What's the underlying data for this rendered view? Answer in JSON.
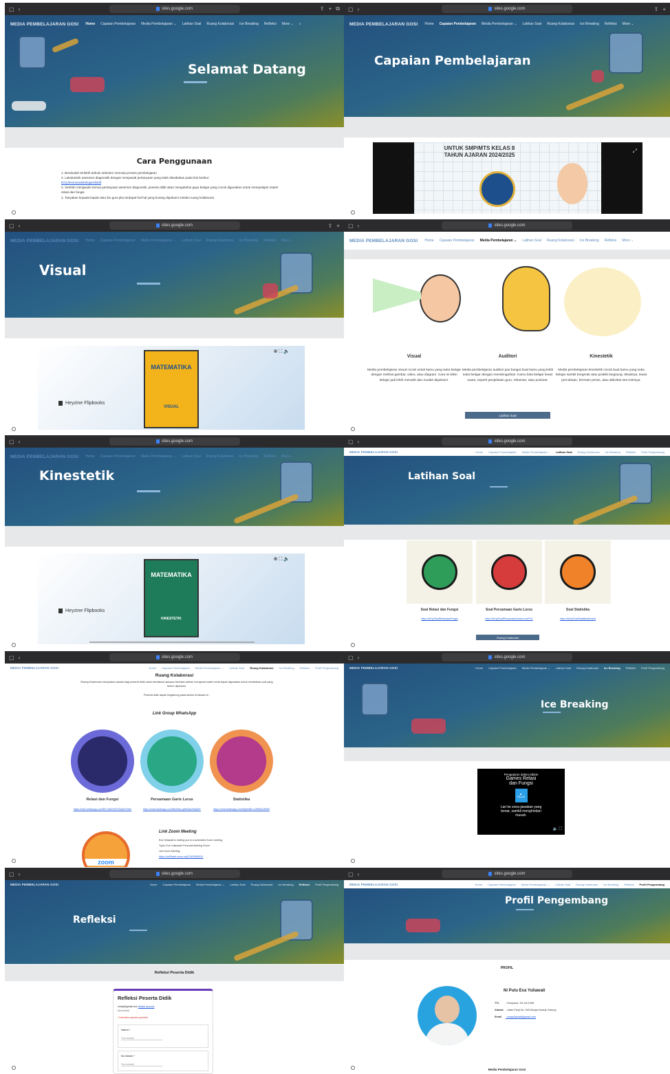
{
  "browser": {
    "url": "sites.google.com"
  },
  "site": {
    "brand": "MEDIA PEMBELAJARAN GOSI",
    "nav": [
      "Home",
      "Capaian Pembelajaran",
      "Media Pembelajaran ⌄",
      "Latihan Soal",
      "Ruang Kolaborasi",
      "Ice Breaking",
      "Refleksi",
      "More ⌄"
    ],
    "nav_wide": [
      "Home",
      "Capaian Pembelajaran",
      "Media Pembelajaran ⌄",
      "Latihan Soal",
      "Ruang Kolaborasi",
      "Ice Breaking",
      "Refleksi",
      "Profil Pengembang"
    ]
  },
  "p1": {
    "title": "Selamat Datang",
    "heading": "Cara Penggunaan",
    "steps": [
      "1. Berdoalah terlebih dahulu sebelum memulai proses pembelajaran",
      "2. Lakukanlah asesmen diagnostik dengan menjawab pertanyaan yang telah disediakan pada link berikut :",
      "bit.ly/tesmetodebelajarefektif",
      "3. Setelah menjawab semua pertanyaan asesmen diagnostik, peserta didik akan mengetahui gaya belajar yang cocok digunakan untuk mempelajari materi relasi dan fungsi.",
      "4. Tanyakan kepada bapak atau ibu guru jika terdapat hal-hal yang kurang dipahami melalui ruang kolaborasi."
    ]
  },
  "p2": {
    "title": "Capaian Pembelajaran",
    "slide_line1": "UNTUK SMP/MTS KELAS 8",
    "slide_line2": "TAHUN AJARAN 2024/2025"
  },
  "p3": {
    "title": "Visual",
    "book_title": "MATEMATIKA",
    "book_tag": "VISUAL",
    "flip": "Heyzine Flipbooks"
  },
  "p4": {
    "cols": [
      {
        "name": "Visual",
        "desc": "Media pembelajaran visual cocok untuk kamu yang suka belajar dengan melihat gambar, video, atau diagram. Cara ini bikin belajar jadi lebih menarik dan mudah dipahami."
      },
      {
        "name": "Auditori",
        "desc": "Media pembelajaran auditori pas banget buat kamu yang lebih suka belajar dengan mendengarkan. Kamu bisa belajar lewat suara, seperti penjelasan guru, rekaman, atau podcast."
      },
      {
        "name": "Kinestetik",
        "desc": "Media pembelajaran kinestetik cocok buat kamu yang suka belajar sambil bergerak atau praktik langsung. Misalnya, lewat percobaan, bermain peran, atau aktivitas seru lainnya."
      }
    ],
    "button": "Latihan Soal"
  },
  "p5": {
    "title": "Kinestetik",
    "book_title": "MATEMATIKA",
    "book_tag": "KINESTETIK",
    "flip": "Heyzine Flipbooks"
  },
  "p6": {
    "title": "Latihan Soal",
    "cards": [
      {
        "name": "Soal Relasi dan Fungsi",
        "link": "https://bit.ly/SoalRelasidanFungsi"
      },
      {
        "name": "Soal Persamaan Garis Lurus",
        "link": "https://bit.ly/SoalPersamaanGarisLurusPGL"
      },
      {
        "name": "Soal Statistika",
        "link": "https://bit.ly/SoalStatistikaKelas8"
      }
    ],
    "button": "Ruang Kolaborasi"
  },
  "p7": {
    "title": "Ruang Kolaborasi",
    "intro": "Ruang Kolaborasi merupakan wadah bagi peserta didik untuk berdiskusi ataupun bertukar pikiran mengenai materi serta dapat digunakan untuk membahas soal yang belum dipahami.",
    "join": "Peserta didik dapat bergabung pada tautan di bawah ini :",
    "wa": "Link Group WhatsApp",
    "groups": [
      {
        "name": "Relasi dan Fungsi",
        "link": "https://chat.whatsapp.com/BYYwtNcF67lCkaNYHdiU"
      },
      {
        "name": "Persamaan Garis Lurus",
        "link": "https://chat.whatsapp.com/BmNbzs qfdWdwAdKpEK"
      },
      {
        "name": "Statistika",
        "link": "https://chat.whatsapp.com/Mpb9dB xc49R6Ju9R83"
      }
    ],
    "zoom_h": "Link Zoom Meeting",
    "zoom_lines": [
      "Eva Yuliawati is inviting you to a scheduled Zoom meeting.",
      "Topic: Eva Yuliawati's Personal Meeting Room",
      "Join Zoom Meeting",
      "https://us05web.zoom.us/j/71676595151"
    ],
    "zoom_logo": "zoom"
  },
  "p8": {
    "title": "Ice Breaking",
    "game_lines": [
      "Pengejaran dalam labirin",
      "Games Relasi",
      "dan Fungsi"
    ],
    "play": "MULAI",
    "foot": "Lari ke zona jawaban yang benar, sambil menghindari musuh."
  },
  "p9": {
    "title": "Refleksi",
    "bar": "Refleksi Peserta Didik",
    "form_title": "Refleksi Peserta Didik",
    "email": "srimpi@gmail.com",
    "switch": "Switch account",
    "not_shared": "Not shared",
    "required": "* Indicates required question",
    "f1": "Nama *",
    "f1p": "Your answer",
    "f2": "No Absen *",
    "f2p": "Your answer"
  },
  "p10": {
    "title": "Profil Pengembang",
    "label": "PROFIL",
    "name": "Ni Putu Eva Yuliawati",
    "ttl_k": "TTL",
    "ttl_v": ": Denpasar, 28 Juli 1998",
    "alamat_k": "Alamat",
    "alamat_v": ": Jalan Panji No. 540 Banjar Kwanji, Dalung",
    "email_k": "Email",
    "email_v": ": evayuliawati@gmail.com",
    "footer": "Media Pembelajaran Gosi"
  }
}
